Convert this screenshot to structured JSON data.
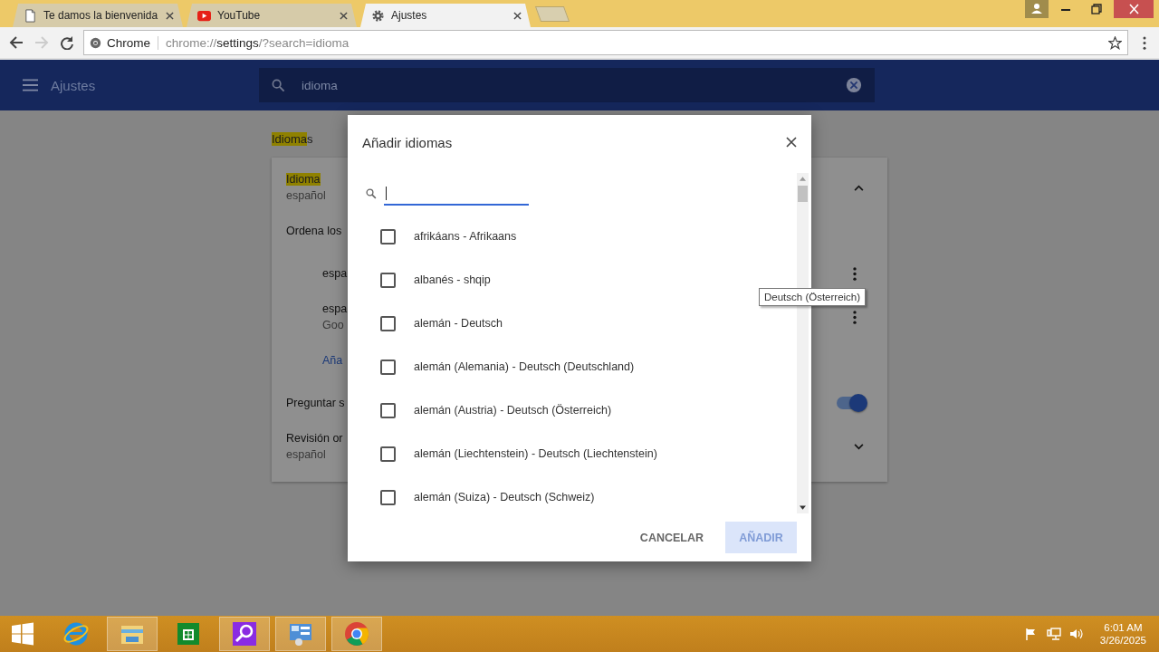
{
  "tabs": [
    {
      "title": "Te damos la bienvenida",
      "kind": "page",
      "selected": false
    },
    {
      "title": "YouTube",
      "kind": "video",
      "selected": false
    },
    {
      "title": "Ajustes",
      "kind": "settings",
      "selected": true
    }
  ],
  "toolbar": {
    "forward_disabled": true,
    "site_label": "Chrome",
    "url_scheme": "chrome://",
    "url_host": "settings",
    "url_rest": "/?search=idioma"
  },
  "settings_header": {
    "title": "Ajustes",
    "search_value": "idioma"
  },
  "page": {
    "section_title": {
      "highlight": "Idioma",
      "rest": "s"
    },
    "card": [
      {
        "kind": "heading",
        "highlight": "Idioma",
        "secondary": "español",
        "expanded": true
      },
      {
        "kind": "label",
        "text": "Ordena los"
      },
      {
        "kind": "language",
        "text": "espa"
      },
      {
        "kind": "language",
        "text": "espa",
        "secondary": "Goo"
      },
      {
        "kind": "link",
        "text": "Aña"
      },
      {
        "kind": "toggle",
        "text": "Preguntar s",
        "on": true
      },
      {
        "kind": "heading",
        "text": "Revisión or",
        "secondary": "español",
        "expanded": false
      }
    ]
  },
  "dialog": {
    "title": "Añadir idiomas",
    "languages": [
      {
        "label": "afrikáans - Afrikaans",
        "checked": false
      },
      {
        "label": "albanés - shqip",
        "checked": false
      },
      {
        "label": "alemán - Deutsch",
        "checked": false
      },
      {
        "label": "alemán (Alemania) - Deutsch (Deutschland)",
        "checked": false
      },
      {
        "label": "alemán (Austria) - Deutsch (Österreich)",
        "checked": false
      },
      {
        "label": "alemán (Liechtenstein) - Deutsch (Liechtenstein)",
        "checked": false
      },
      {
        "label": "alemán (Suiza) - Deutsch (Schweiz)",
        "checked": false
      }
    ],
    "cancel": "CANCELAR",
    "add": {
      "label": "AÑADIR",
      "disabled": true
    }
  },
  "tooltip": "Deutsch (Österreich)",
  "taskbar": {
    "apps": [
      {
        "kind": "ie",
        "open": false
      },
      {
        "kind": "explorer",
        "open": true
      },
      {
        "kind": "store",
        "open": false
      },
      {
        "kind": "search",
        "open": true
      },
      {
        "kind": "control",
        "open": true
      },
      {
        "kind": "chrome",
        "open": true
      }
    ],
    "time": "6:01 AM",
    "date": "3/26/2025"
  }
}
